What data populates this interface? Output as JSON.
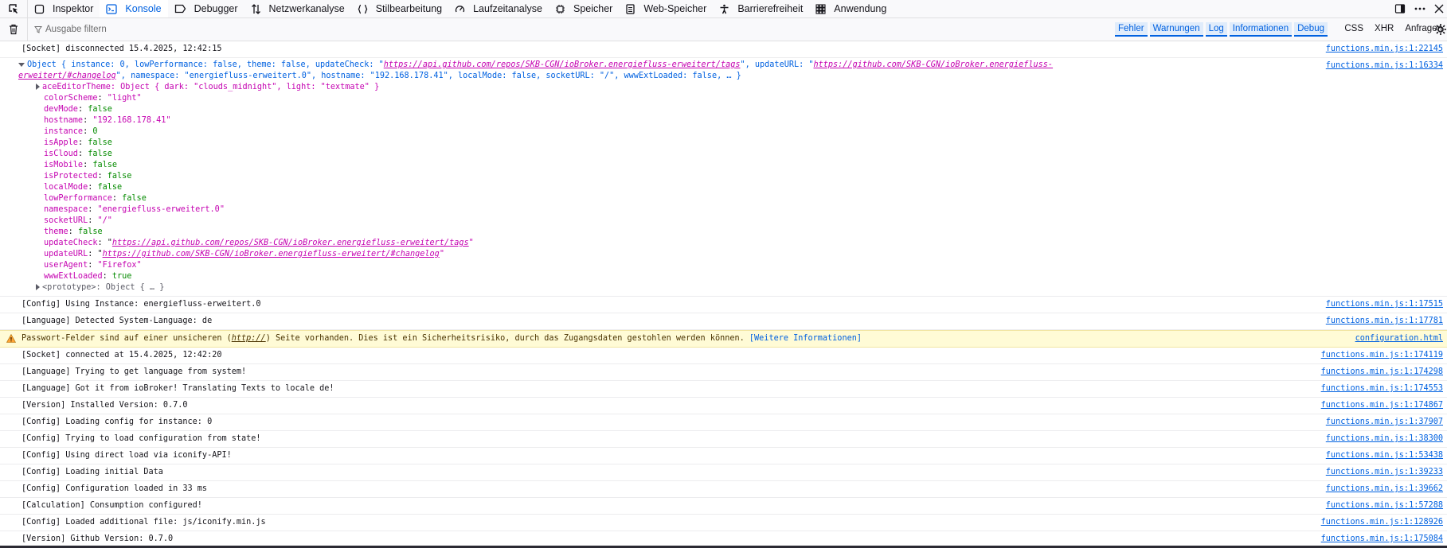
{
  "toolbar": {
    "tabs": [
      {
        "label": "Inspektor",
        "icon": "inspector-icon"
      },
      {
        "label": "Konsole",
        "icon": "console-icon",
        "active": true
      },
      {
        "label": "Debugger",
        "icon": "debugger-icon"
      },
      {
        "label": "Netzwerkanalyse",
        "icon": "network-icon"
      },
      {
        "label": "Stilbearbeitung",
        "icon": "style-editor-icon"
      },
      {
        "label": "Laufzeitanalyse",
        "icon": "performance-icon"
      },
      {
        "label": "Speicher",
        "icon": "memory-icon"
      },
      {
        "label": "Web-Speicher",
        "icon": "storage-icon"
      },
      {
        "label": "Barrierefreiheit",
        "icon": "accessibility-icon"
      },
      {
        "label": "Anwendung",
        "icon": "application-icon"
      }
    ],
    "accent": "#0061e0"
  },
  "filterbar": {
    "placeholder": "Ausgabe filtern",
    "levels": [
      "Fehler",
      "Warnungen",
      "Log",
      "Informationen",
      "Debug"
    ],
    "requests": [
      "CSS",
      "XHR",
      "Anfragen"
    ]
  },
  "console": {
    "msg_socket_disc": {
      "text": "[Socket] disconnected 15.4.2025, 12:42:15",
      "loc": "functions.min.js:1:22145"
    },
    "obj": {
      "loc": "functions.min.js:1:16334",
      "head_prefix": "Object { instance: 0, lowPerformance: false, theme: false, updateCheck: \"",
      "head_url1": "https://api.github.com/repos/SKB-CGN/ioBroker.energiefluss-erweitert/tags",
      "head_mid": "\", updateURL: \"",
      "head_url2": "https://github.com/SKB-CGN/ioBroker.energiefluss-erweitert/#changelog",
      "head_rest": "\", namespace: \"energiefluss-erweitert.0\", hostname: \"192.168.178.41\", localMode: false, socketURL: \"/\", wwwExtLoaded: false, … }",
      "ace": "aceEditorTheme: Object { dark: \"clouds_midnight\", light: \"textmate\" }",
      "props": [
        {
          "k": "colorScheme",
          "v": "\"light\"",
          "t": "str"
        },
        {
          "k": "devMode",
          "v": "false",
          "t": "bool"
        },
        {
          "k": "hostname",
          "v": "\"192.168.178.41\"",
          "t": "str"
        },
        {
          "k": "instance",
          "v": "0",
          "t": "num"
        },
        {
          "k": "isApple",
          "v": "false",
          "t": "bool"
        },
        {
          "k": "isCloud",
          "v": "false",
          "t": "bool"
        },
        {
          "k": "isMobile",
          "v": "false",
          "t": "bool"
        },
        {
          "k": "isProtected",
          "v": "false",
          "t": "bool"
        },
        {
          "k": "localMode",
          "v": "false",
          "t": "bool"
        },
        {
          "k": "lowPerformance",
          "v": "false",
          "t": "bool"
        },
        {
          "k": "namespace",
          "v": "\"energiefluss-erweitert.0\"",
          "t": "str"
        },
        {
          "k": "socketURL",
          "v": "\"/\"",
          "t": "str"
        },
        {
          "k": "theme",
          "v": "false",
          "t": "bool"
        }
      ],
      "updateCheck_key": "updateCheck",
      "updateCheck_val": "https://api.github.com/repos/SKB-CGN/ioBroker.energiefluss-erweitert/tags",
      "updateURL_key": "updateURL",
      "updateURL_val": "https://github.com/SKB-CGN/ioBroker.energiefluss-erweitert/#changelog",
      "userAgent_key": "userAgent",
      "userAgent_val": "\"Firefox\"",
      "wwwExt_key": "wwwExtLoaded",
      "wwwExt_val": "true",
      "proto": "<prototype>: Object { … }"
    },
    "msg_cfg_inst": {
      "text": "[Config] Using Instance: energiefluss-erweitert.0",
      "loc": "functions.min.js:1:17515"
    },
    "msg_lang_det": {
      "text": "[Language] Detected System-Language: de",
      "loc": "functions.min.js:1:17781"
    },
    "warn": {
      "pre": "Passwort-Felder sind auf einer unsicheren (",
      "link": "http://",
      "post": ") Seite vorhanden. Dies ist ein Sicherheitsrisiko, durch das Zugangsdaten gestohlen werden können. ",
      "more": "[Weitere Informationen]",
      "loc": "configuration.html",
      "color": "#fffbd6"
    },
    "messages": [
      {
        "text": "[Socket] connected at 15.4.2025, 12:42:20",
        "loc": "functions.min.js:1:174119"
      },
      {
        "text": "[Language] Trying to get language from system!",
        "loc": "functions.min.js:1:174298"
      },
      {
        "text": "[Language] Got it from ioBroker! Translating Texts to locale de!",
        "loc": "functions.min.js:1:174553"
      },
      {
        "text": "[Version] Installed Version: 0.7.0",
        "loc": "functions.min.js:1:174867"
      },
      {
        "text": "[Config] Loading config for instance: 0",
        "loc": "functions.min.js:1:37907"
      },
      {
        "text": "[Config] Trying to load configuration from state!",
        "loc": "functions.min.js:1:38300"
      },
      {
        "text": "[Config] Using direct load via iconify-API!",
        "loc": "functions.min.js:1:53438"
      },
      {
        "text": "[Config] Loading initial Data",
        "loc": "functions.min.js:1:39233"
      },
      {
        "text": "[Config] Configuration loaded in 33 ms",
        "loc": "functions.min.js:1:39662"
      },
      {
        "text": "[Calculation] Consumption configured!",
        "loc": "functions.min.js:1:57288"
      },
      {
        "text": "[Config] Loaded additional file: js/iconify.min.js",
        "loc": "functions.min.js:1:128926"
      },
      {
        "text": "[Version] Github Version: 0.7.0",
        "loc": "functions.min.js:1:175084"
      }
    ]
  }
}
